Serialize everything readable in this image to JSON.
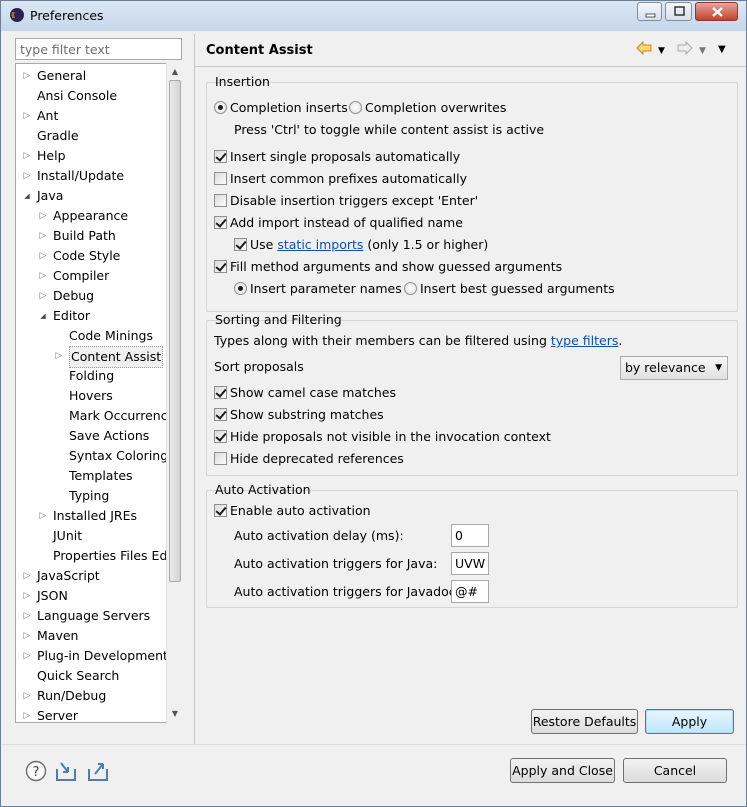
{
  "window": {
    "title": "Preferences"
  },
  "filter": {
    "placeholder": "type filter text"
  },
  "tree": [
    {
      "label": "General",
      "level": 0,
      "arrow": "right"
    },
    {
      "label": "Ansi Console",
      "level": 0,
      "arrow": ""
    },
    {
      "label": "Ant",
      "level": 0,
      "arrow": "right"
    },
    {
      "label": "Gradle",
      "level": 0,
      "arrow": ""
    },
    {
      "label": "Help",
      "level": 0,
      "arrow": "right"
    },
    {
      "label": "Install/Update",
      "level": 0,
      "arrow": "right"
    },
    {
      "label": "Java",
      "level": 0,
      "arrow": "down"
    },
    {
      "label": "Appearance",
      "level": 1,
      "arrow": "right"
    },
    {
      "label": "Build Path",
      "level": 1,
      "arrow": "right"
    },
    {
      "label": "Code Style",
      "level": 1,
      "arrow": "right"
    },
    {
      "label": "Compiler",
      "level": 1,
      "arrow": "right"
    },
    {
      "label": "Debug",
      "level": 1,
      "arrow": "right"
    },
    {
      "label": "Editor",
      "level": 1,
      "arrow": "down"
    },
    {
      "label": "Code Minings",
      "level": 2,
      "arrow": ""
    },
    {
      "label": "Content Assist",
      "level": 2,
      "arrow": "right",
      "selected": true
    },
    {
      "label": "Folding",
      "level": 2,
      "arrow": ""
    },
    {
      "label": "Hovers",
      "level": 2,
      "arrow": ""
    },
    {
      "label": "Mark Occurrences",
      "level": 2,
      "arrow": ""
    },
    {
      "label": "Save Actions",
      "level": 2,
      "arrow": ""
    },
    {
      "label": "Syntax Coloring",
      "level": 2,
      "arrow": ""
    },
    {
      "label": "Templates",
      "level": 2,
      "arrow": ""
    },
    {
      "label": "Typing",
      "level": 2,
      "arrow": ""
    },
    {
      "label": "Installed JREs",
      "level": 1,
      "arrow": "right"
    },
    {
      "label": "JUnit",
      "level": 1,
      "arrow": ""
    },
    {
      "label": "Properties Files Editor",
      "level": 1,
      "arrow": ""
    },
    {
      "label": "JavaScript",
      "level": 0,
      "arrow": "right"
    },
    {
      "label": "JSON",
      "level": 0,
      "arrow": "right"
    },
    {
      "label": "Language Servers",
      "level": 0,
      "arrow": "right"
    },
    {
      "label": "Maven",
      "level": 0,
      "arrow": "right"
    },
    {
      "label": "Plug-in Development",
      "level": 0,
      "arrow": "right"
    },
    {
      "label": "Quick Search",
      "level": 0,
      "arrow": ""
    },
    {
      "label": "Run/Debug",
      "level": 0,
      "arrow": "right"
    },
    {
      "label": "Server",
      "level": 0,
      "arrow": "right"
    }
  ],
  "page": {
    "title": "Content Assist"
  },
  "insertion": {
    "title": "Insertion",
    "completion_inserts": "Completion inserts",
    "completion_overwrites": "Completion overwrites",
    "toggle_hint": "Press 'Ctrl' to toggle while content assist is active",
    "insert_single": "Insert single proposals automatically",
    "insert_common": "Insert common prefixes automatically",
    "disable_triggers": "Disable insertion triggers except 'Enter'",
    "add_import": "Add import instead of qualified name",
    "use_label": "Use",
    "static_imports_link": "static imports",
    "static_imports_suffix": "(only 1.5 or higher)",
    "fill_args": "Fill method arguments and show guessed arguments",
    "insert_param_names": "Insert parameter names",
    "insert_best_guessed": "Insert best guessed arguments"
  },
  "sorting": {
    "title": "Sorting and Filtering",
    "types_text": "Types along with their members can be filtered using",
    "type_filters_link": "type filters",
    "period": ".",
    "sort_label": "Sort proposals",
    "sort_value": "by relevance",
    "camel_case": "Show camel case matches",
    "substring": "Show substring matches",
    "hide_not_visible": "Hide proposals not visible in the invocation context",
    "hide_deprecated": "Hide deprecated references"
  },
  "auto": {
    "title": "Auto Activation",
    "enable": "Enable auto activation",
    "delay_label": "Auto activation delay (ms):",
    "delay_value": "0",
    "java_label": "Auto activation triggers for Java:",
    "java_value": "UVW",
    "javadoc_label": "Auto activation triggers for Javadoc:",
    "javadoc_value": "@#"
  },
  "buttons": {
    "restore_defaults": "Restore Defaults",
    "apply": "Apply",
    "apply_and_close": "Apply and Close",
    "cancel": "Cancel"
  }
}
